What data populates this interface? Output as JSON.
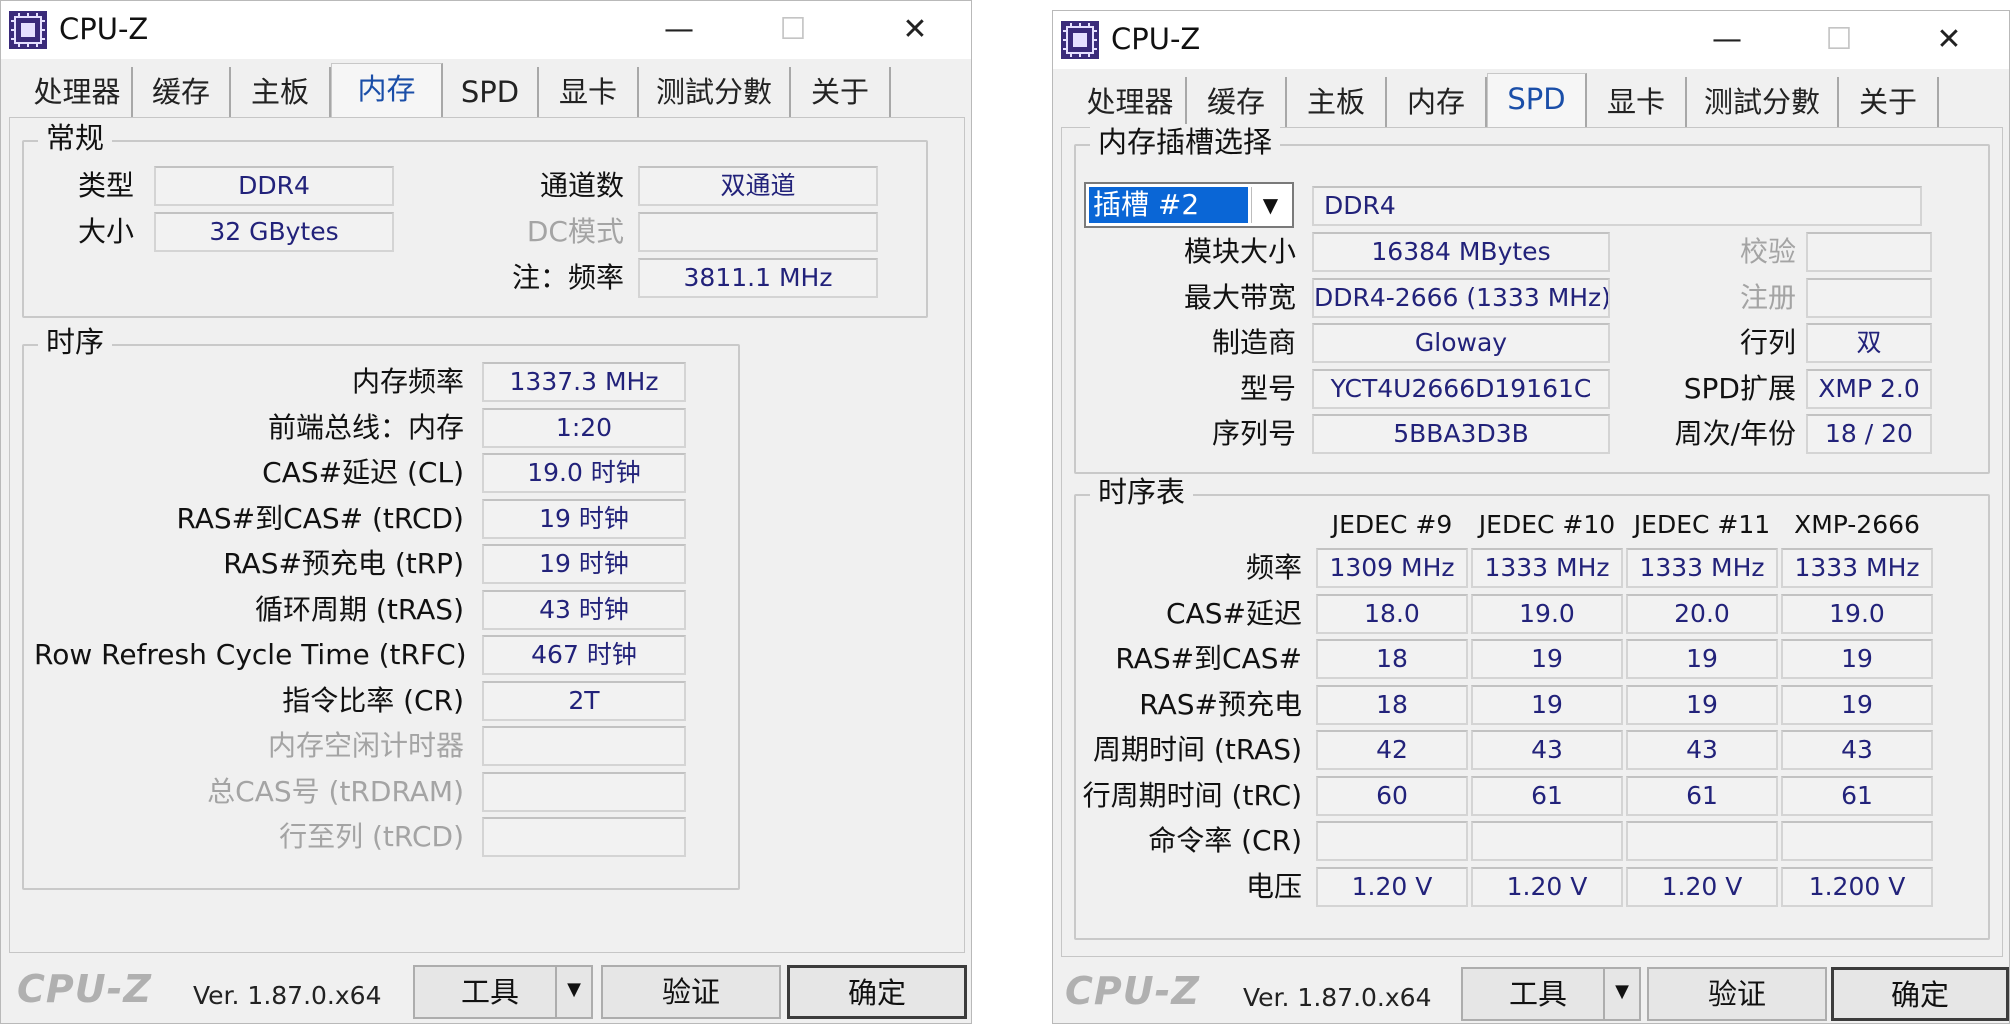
{
  "left": {
    "title": "CPU-Z",
    "window_controls": {
      "minimize": "—",
      "maximize": "☐",
      "close": "✕"
    },
    "tabs": [
      "处理器",
      "缓存",
      "主板",
      "内存",
      "SPD",
      "显卡",
      "测試分數",
      "关于"
    ],
    "active_tab": "内存",
    "general": {
      "legend": "常规",
      "type_label": "类型",
      "type_value": "DDR4",
      "size_label": "大小",
      "size_value": "32 GBytes",
      "channels_label": "通道数",
      "channels_value": "双通道",
      "dc_label": "DC模式",
      "dc_value": "",
      "freq_label": "注：频率",
      "freq_value": "3811.1 MHz"
    },
    "timings": {
      "legend": "时序",
      "rows": [
        {
          "label": "内存频率",
          "value": "1337.3 MHz",
          "dim": false
        },
        {
          "label": "前端总线：内存",
          "value": "1:20",
          "dim": false
        },
        {
          "label": "CAS#延迟 (CL)",
          "value": "19.0 时钟",
          "dim": false
        },
        {
          "label": "RAS#到CAS# (tRCD)",
          "value": "19 时钟",
          "dim": false
        },
        {
          "label": "RAS#预充电 (tRP)",
          "value": "19 时钟",
          "dim": false
        },
        {
          "label": "循环周期 (tRAS)",
          "value": "43 时钟",
          "dim": false
        },
        {
          "label": "Row Refresh Cycle Time (tRFC)",
          "value": "467 时钟",
          "dim": false
        },
        {
          "label": "指令比率 (CR)",
          "value": "2T",
          "dim": false
        },
        {
          "label": "内存空闲计时器",
          "value": "",
          "dim": true
        },
        {
          "label": "总CAS号 (tRDRAM)",
          "value": "",
          "dim": true
        },
        {
          "label": "行至列 (tRCD)",
          "value": "",
          "dim": true
        }
      ]
    },
    "footer": {
      "logo": "CPU-Z",
      "version": "Ver. 1.87.0.x64",
      "tools": "工具",
      "validate": "验证",
      "ok": "确定",
      "dd_arrow": "▼"
    }
  },
  "right": {
    "title": "CPU-Z",
    "window_controls": {
      "minimize": "—",
      "maximize": "☐",
      "close": "✕"
    },
    "tabs": [
      "处理器",
      "缓存",
      "主板",
      "内存",
      "SPD",
      "显卡",
      "测試分數",
      "关于"
    ],
    "active_tab": "SPD",
    "slot": {
      "legend": "内存插槽选择",
      "selected": "插槽 #2",
      "dd_arrow": "▼",
      "type_value": "DDR4",
      "rows_left": [
        {
          "label": "模块大小",
          "value": "16384 MBytes"
        },
        {
          "label": "最大带宽",
          "value": "DDR4-2666 (1333 MHz)"
        },
        {
          "label": "制造商",
          "value": "Gloway"
        },
        {
          "label": "型号",
          "value": "YCT4U2666D19161C"
        },
        {
          "label": "序列号",
          "value": "5BBA3D3B"
        }
      ],
      "rows_right": [
        {
          "label": "校验",
          "value": "",
          "dim": true
        },
        {
          "label": "注册",
          "value": "",
          "dim": true
        },
        {
          "label": "行列",
          "value": "双",
          "dim": false
        },
        {
          "label": "SPD扩展",
          "value": "XMP 2.0",
          "dim": false
        },
        {
          "label": "周次/年份",
          "value": "18 / 20",
          "dim": false
        }
      ]
    },
    "timing_table": {
      "legend": "时序表",
      "columns": [
        "JEDEC #9",
        "JEDEC #10",
        "JEDEC #11",
        "XMP-2666"
      ],
      "rows": [
        {
          "label": "频率",
          "values": [
            "1309 MHz",
            "1333 MHz",
            "1333 MHz",
            "1333 MHz"
          ]
        },
        {
          "label": "CAS#延迟",
          "values": [
            "18.0",
            "19.0",
            "20.0",
            "19.0"
          ]
        },
        {
          "label": "RAS#到CAS#",
          "values": [
            "18",
            "19",
            "19",
            "19"
          ]
        },
        {
          "label": "RAS#预充电",
          "values": [
            "18",
            "19",
            "19",
            "19"
          ]
        },
        {
          "label": "周期时间 (tRAS)",
          "values": [
            "42",
            "43",
            "43",
            "43"
          ]
        },
        {
          "label": "行周期时间 (tRC)",
          "values": [
            "60",
            "61",
            "61",
            "61"
          ]
        },
        {
          "label": "命令率 (CR)",
          "values": [
            "",
            "",
            "",
            ""
          ]
        },
        {
          "label": "电压",
          "values": [
            "1.20 V",
            "1.20 V",
            "1.20 V",
            "1.200 V"
          ]
        }
      ]
    },
    "footer": {
      "logo": "CPU-Z",
      "version": "Ver. 1.87.0.x64",
      "tools": "工具",
      "validate": "验证",
      "ok": "确定",
      "dd_arrow": "▼"
    }
  },
  "colors": {
    "value_text": "#22227a",
    "active_tab": "#1a4ea8",
    "icon_bg": "#3a2a7a",
    "select_bg": "#0a66d6"
  }
}
